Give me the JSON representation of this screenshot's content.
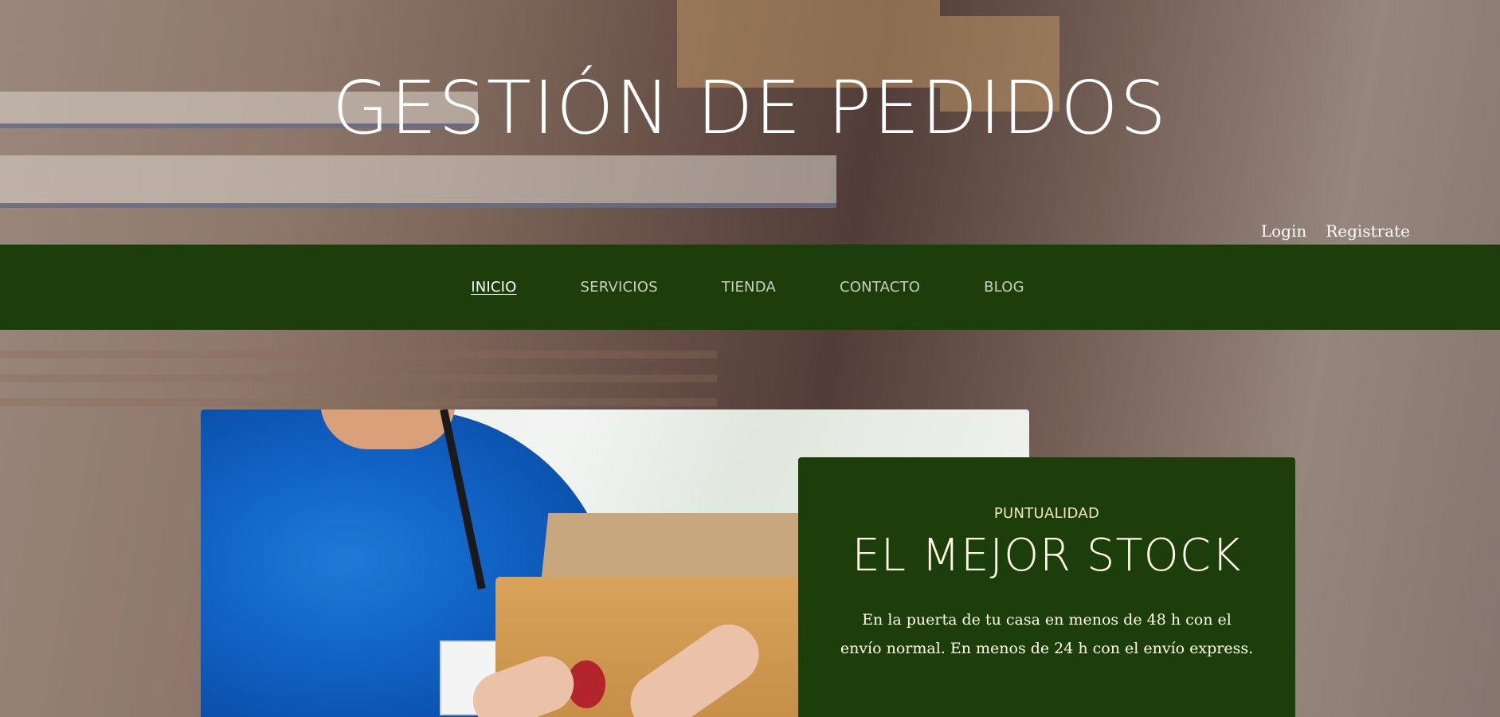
{
  "hero": {
    "title": "GESTIÓN DE PEDIDOS"
  },
  "auth": {
    "login": "Login",
    "register": "Registrate"
  },
  "nav": {
    "items": [
      {
        "label": "INICIO",
        "active": true
      },
      {
        "label": "SERVICIOS",
        "active": false
      },
      {
        "label": "TIENDA",
        "active": false
      },
      {
        "label": "CONTACTO",
        "active": false
      },
      {
        "label": "BLOG",
        "active": false
      }
    ]
  },
  "feature": {
    "kicker": "PUNTUALIDAD",
    "headline": "EL MEJOR STOCK",
    "body": "En la puerta de tu casa en menos de 48 h con el envío normal. En menos de 24 h con el envío express."
  },
  "colors": {
    "nav_bg": "#1c3e0a",
    "card_bg": "#1c3e0a",
    "kicker": "#f4e7b3",
    "text_light": "#ffffff"
  }
}
